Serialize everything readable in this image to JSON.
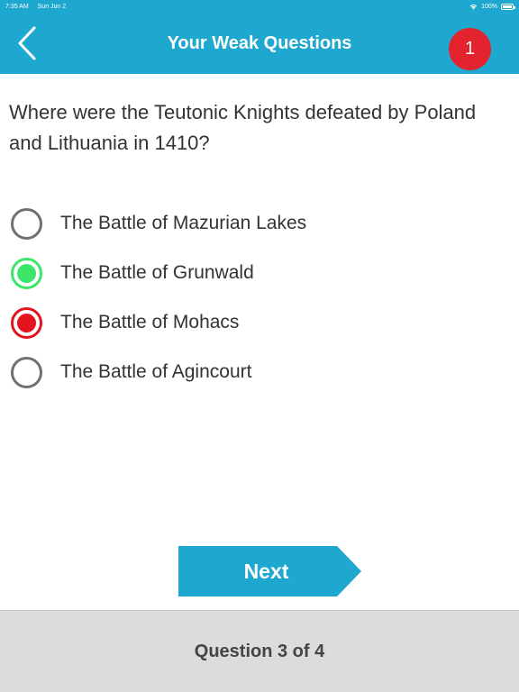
{
  "status_bar": {
    "time": "7:35 AM",
    "date": "Sun Jun 2",
    "battery": "100%"
  },
  "nav": {
    "title": "Your Weak Questions",
    "badge_count": "1",
    "back_icon": "chevron-left-icon"
  },
  "question": {
    "text": "Where were the Teutonic Knights defeated by Poland and Lithuania in 1410?"
  },
  "answers": [
    {
      "label": "The Battle of Mazurian Lakes",
      "state": "unselected"
    },
    {
      "label": "The Battle of Grunwald",
      "state": "correct"
    },
    {
      "label": "The Battle of Mohacs",
      "state": "wrong"
    },
    {
      "label": "The Battle of Agincourt",
      "state": "unselected"
    }
  ],
  "next_button": {
    "label": "Next"
  },
  "footer": {
    "progress": "Question 3 of 4"
  },
  "colors": {
    "primary": "#1ea7cf",
    "badge": "#e3232e",
    "correct": "#3ce66a",
    "wrong": "#e3141e",
    "footer_bg": "#dcdcdc"
  }
}
